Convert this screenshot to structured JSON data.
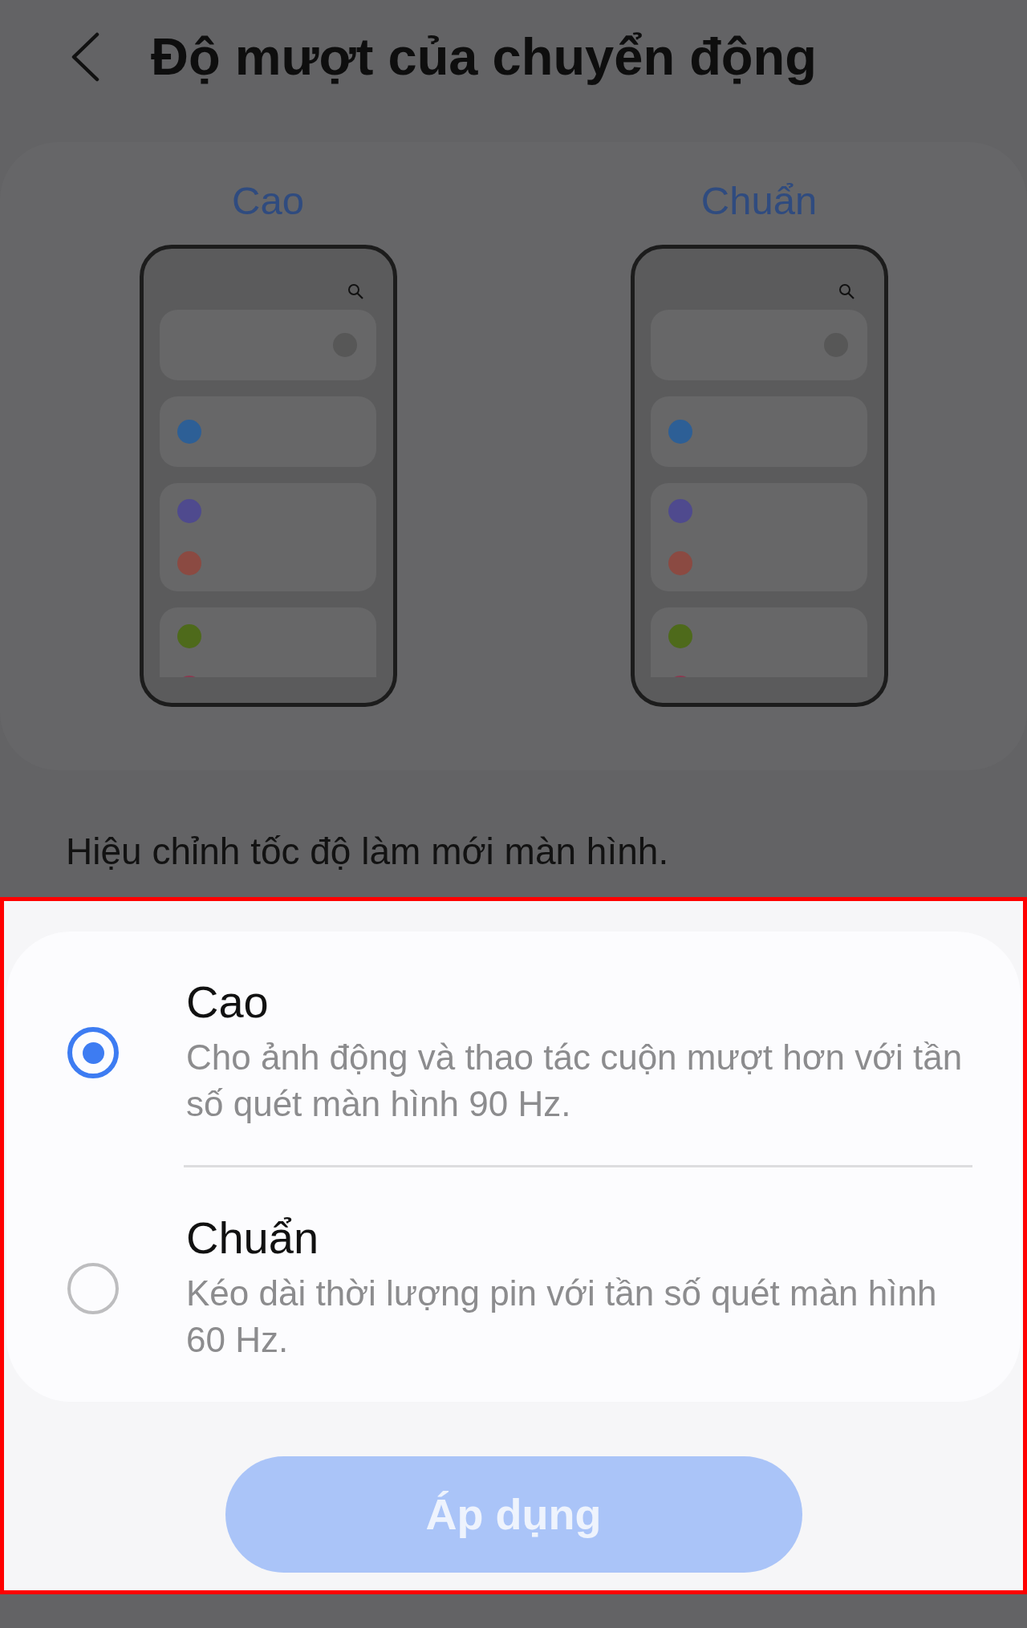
{
  "header": {
    "title": "Độ mượt của chuyển động"
  },
  "previews": [
    {
      "label": "Cao"
    },
    {
      "label": "Chuẩn"
    }
  ],
  "description": "Hiệu chỉnh tốc độ làm mới màn hình.",
  "options": [
    {
      "title": "Cao",
      "description": "Cho ảnh động và thao tác cuộn mượt hơn với tần số quét màn hình 90 Hz.",
      "selected": true
    },
    {
      "title": "Chuẩn",
      "description": "Kéo dài thời lượng pin với tần số quét màn hình 60 Hz.",
      "selected": false
    }
  ],
  "apply_button": {
    "label": "Áp dụng",
    "disabled": true
  }
}
